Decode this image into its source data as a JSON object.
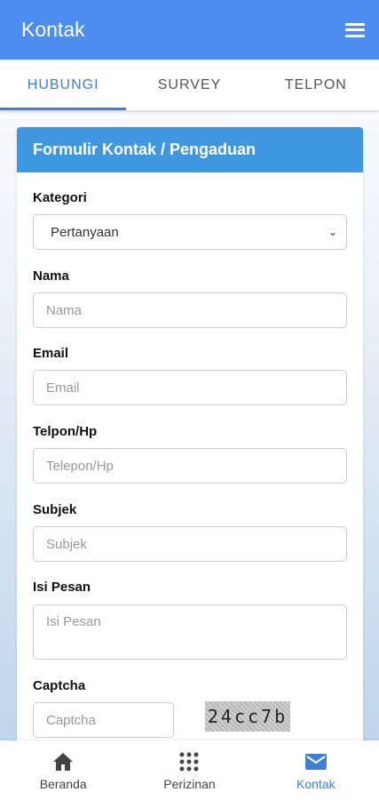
{
  "appbar": {
    "title": "Kontak",
    "menu_icon": "hamburger-menu-icon"
  },
  "tabs": [
    {
      "label": "HUBUNGI",
      "active": true
    },
    {
      "label": "SURVEY",
      "active": false
    },
    {
      "label": "TELPON",
      "active": false
    }
  ],
  "form": {
    "title": "Formulir Kontak / Pengaduan",
    "kategori": {
      "label": "Kategori",
      "value": "Pertanyaan"
    },
    "nama": {
      "label": "Nama",
      "placeholder": "Nama"
    },
    "email": {
      "label": "Email",
      "placeholder": "Email"
    },
    "telpon": {
      "label": "Telpon/Hp",
      "placeholder": "Telepon/Hp"
    },
    "subjek": {
      "label": "Subjek",
      "placeholder": "Subjek"
    },
    "pesan": {
      "label": "Isi Pesan",
      "placeholder": "Isi Pesan"
    },
    "captcha": {
      "label": "Captcha",
      "placeholder": "Captcha",
      "code": "24cc7b"
    }
  },
  "bottom_nav": [
    {
      "label": "Beranda",
      "icon": "home-icon",
      "active": false
    },
    {
      "label": "Perizinan",
      "icon": "grid-icon",
      "active": false
    },
    {
      "label": "Kontak",
      "icon": "mail-icon",
      "active": true
    }
  ],
  "colors": {
    "primary": "#4d8df0",
    "card_header": "#3f97df",
    "active": "#3d7fd4"
  }
}
